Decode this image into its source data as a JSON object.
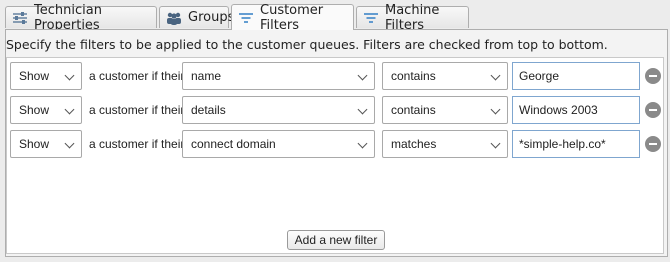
{
  "tabs": [
    {
      "label": "Technician Properties",
      "icon": "sliders-icon"
    },
    {
      "label": "Groups",
      "icon": "group-icon"
    },
    {
      "label": "Customer Filters",
      "icon": "filter-icon",
      "active": true
    },
    {
      "label": "Machine Filters",
      "icon": "filter-icon"
    }
  ],
  "description": "Specify the filters to be applied to the customer queues. Filters are checked from top to bottom.",
  "filters": [
    {
      "action": "Show",
      "connector": "a customer if their",
      "field": "name",
      "operator": "contains",
      "value": "George"
    },
    {
      "action": "Show",
      "connector": "a customer if their",
      "field": "details",
      "operator": "contains",
      "value": "Windows 2003"
    },
    {
      "action": "Show",
      "connector": "a customer if their",
      "field": "connect domain",
      "operator": "matches",
      "value": "*simple-help.co*"
    }
  ],
  "add_filter_label": "Add a new filter"
}
